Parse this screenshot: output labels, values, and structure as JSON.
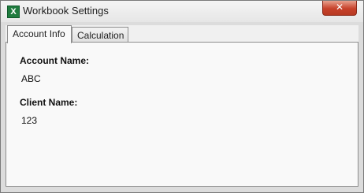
{
  "window": {
    "title": "Workbook Settings",
    "app_icon_glyph": "X",
    "close_glyph": "✕"
  },
  "tabs": [
    {
      "label": "Account Info",
      "active": true
    },
    {
      "label": "Calculation",
      "active": false
    }
  ],
  "account_info": {
    "account_name_label": "Account Name:",
    "account_name_value": "ABC",
    "client_name_label": "Client Name:",
    "client_name_value": "123"
  }
}
